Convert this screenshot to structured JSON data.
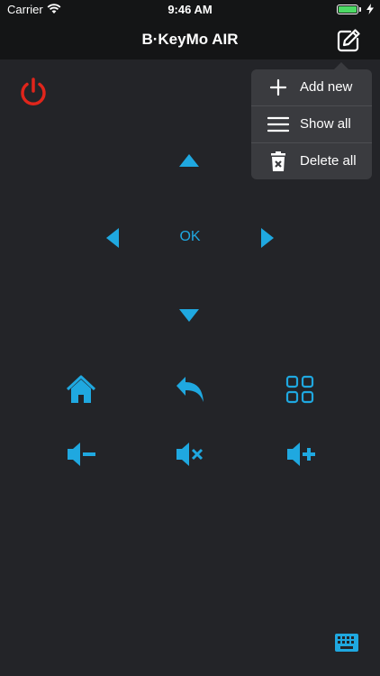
{
  "status": {
    "carrier": "Carrier",
    "time": "9:46 AM"
  },
  "nav": {
    "title": "B·KeyMo AIR",
    "edit_icon": "edit-icon"
  },
  "remote": {
    "power_icon": "power-icon",
    "ok_label": "OK",
    "accent_color": "#1fa8e0",
    "power_color": "#e0251b",
    "controls": [
      "home-icon",
      "back-icon",
      "apps-grid-icon",
      "volume-down-icon",
      "mute-icon",
      "volume-up-icon"
    ]
  },
  "menu": {
    "items": [
      {
        "label": "Add new",
        "icon": "plus-icon"
      },
      {
        "label": "Show all",
        "icon": "list-icon"
      },
      {
        "label": "Delete all",
        "icon": "trash-icon"
      }
    ]
  }
}
